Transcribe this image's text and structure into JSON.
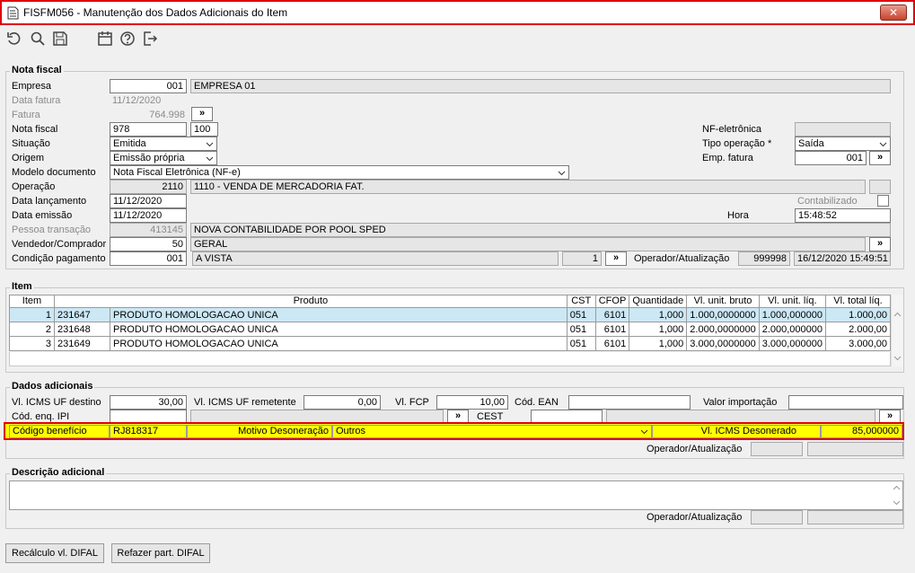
{
  "window": {
    "title": "FISFM056 - Manutenção dos Dados Adicionais do Item",
    "close_glyph": "✕"
  },
  "nota": {
    "legend": "Nota fiscal",
    "empresa_label": "Empresa",
    "empresa_value": "001",
    "empresa_name": "EMPRESA 01",
    "data_fatura_label": "Data fatura",
    "data_fatura_value": "11/12/2020",
    "fatura_label": "Fatura",
    "fatura_value": "764.998",
    "nota_fiscal_label": "Nota fiscal",
    "nota_fiscal_value": "978",
    "nota_serie": "100",
    "situacao_label": "Situação",
    "situacao_value": "Emitida",
    "origem_label": "Origem",
    "origem_value": "Emissão própria",
    "modelo_label": "Modelo documento",
    "modelo_value": "Nota Fiscal Eletrônica (NF-e)",
    "operacao_label": "Operação",
    "operacao_code": "2110",
    "operacao_desc": "1110 - VENDA DE MERCADORIA FAT.",
    "data_lanc_label": "Data lançamento",
    "data_lanc_value": "11/12/2020",
    "data_emissao_label": "Data emissão",
    "data_emissao_value": "11/12/2020",
    "pessoa_label": "Pessoa transação",
    "pessoa_code": "413145",
    "pessoa_desc": "NOVA CONTABILIDADE POR POOL SPED",
    "vendedor_label": "Vendedor/Comprador",
    "vendedor_code": "50",
    "vendedor_desc": "GERAL",
    "cond_label": "Condição pagamento",
    "cond_code": "001",
    "cond_desc": "A VISTA",
    "cond_num": "1",
    "nfe_label": "NF-eletrônica",
    "nfe_value": "",
    "tipo_op_label": "Tipo operação *",
    "tipo_op_value": "Saída",
    "emp_fatura_label": "Emp. fatura",
    "emp_fatura_value": "001",
    "contabilizado_label": "Contabilizado",
    "hora_label": "Hora",
    "hora_value": "15:48:52",
    "oper_label": "Operador/Atualização",
    "oper_code": "999998",
    "oper_date": "16/12/2020 15:49:51",
    "lookup_glyph": "»"
  },
  "item": {
    "legend": "Item",
    "columns": [
      "Item",
      "Produto",
      "CST",
      "CFOP",
      "Quantidade",
      "Vl. unit. bruto",
      "Vl. unit. líq.",
      "Vl. total líq."
    ],
    "rows": [
      {
        "item": "1",
        "code": "231647",
        "produto": "PRODUTO HOMOLOGACAO UNICA",
        "cst": "051",
        "cfop": "6101",
        "qtd": "1,000",
        "bruto": "1.000,0000000",
        "liq": "1.000,000000",
        "total": "1.000,00"
      },
      {
        "item": "2",
        "code": "231648",
        "produto": "PRODUTO HOMOLOGACAO UNICA",
        "cst": "051",
        "cfop": "6101",
        "qtd": "1,000",
        "bruto": "2.000,0000000",
        "liq": "2.000,000000",
        "total": "2.000,00"
      },
      {
        "item": "3",
        "code": "231649",
        "produto": "PRODUTO HOMOLOGACAO UNICA",
        "cst": "051",
        "cfop": "6101",
        "qtd": "1,000",
        "bruto": "3.000,0000000",
        "liq": "3.000,000000",
        "total": "3.000,00"
      }
    ]
  },
  "dados": {
    "legend": "Dados adicionais",
    "icms_dest_label": "Vl. ICMS UF destino",
    "icms_dest_value": "30,00",
    "icms_rem_label": "Vl. ICMS UF remetente",
    "icms_rem_value": "0,00",
    "fcp_label": "Vl. FCP",
    "fcp_value": "10,00",
    "ean_label": "Cód. EAN",
    "ean_value": "",
    "valor_imp_label": "Valor importação",
    "valor_imp_value": "",
    "enq_ipi_label": "Cód. enq. IPI",
    "enq_ipi_value": "",
    "cest_label": "CEST",
    "cest_value": "",
    "cod_benef_label": "Código benefício",
    "cod_benef_value": "RJ818317",
    "motivo_label": "Motivo Desoneração",
    "motivo_value": "Outros",
    "icms_deson_label": "Vl. ICMS Desonerado",
    "icms_deson_value": "85,000000",
    "oper_label": "Operador/Atualização"
  },
  "descricao": {
    "legend": "Descrição adicional",
    "oper_label": "Operador/Atualização"
  },
  "buttons": {
    "recalc": "Recálculo vl. DIFAL",
    "refazer": "Refazer part. DIFAL"
  },
  "colors": {
    "highlight": "#ffff00",
    "frame": "#e00000",
    "selected_row": "#cce8f4"
  }
}
